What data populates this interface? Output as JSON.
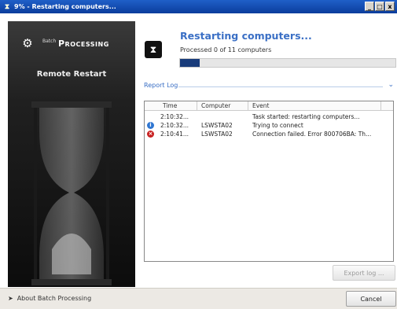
{
  "window": {
    "title": "9% - Restarting computers...",
    "min_glyph": "_",
    "max_glyph": "□",
    "close_glyph": "x"
  },
  "brand": {
    "batch": "Batch",
    "processing": "Processing"
  },
  "tool": {
    "name": "Remote Restart"
  },
  "task": {
    "title": "Restarting computers...",
    "subtitle": "Processed 0 of 11 computers",
    "progress_fraction": 0.09
  },
  "report": {
    "label": "Report Log"
  },
  "log": {
    "headers": {
      "time": "Time",
      "computer": "Computer",
      "event": "Event"
    },
    "rows": [
      {
        "severity": "none",
        "time": "2:10:32...",
        "computer": "",
        "event": "Task started: restarting computers..."
      },
      {
        "severity": "info",
        "time": "2:10:32...",
        "computer": "LSWSTA02",
        "event": "Trying to connect"
      },
      {
        "severity": "error",
        "time": "2:10:41...",
        "computer": "LSWSTA02",
        "event": "Connection failed. Error 800706BA: Th..."
      }
    ]
  },
  "buttons": {
    "export": "Export log ...",
    "cancel": "Cancel"
  },
  "footer": {
    "about": "About Batch Processing"
  },
  "colors": {
    "accent": "#3a6fc5",
    "progress": "#183b7a",
    "titlebar": "#0b3d9c"
  },
  "icons": {
    "title": "hourglass-icon",
    "brand": "gear-icon",
    "task": "hourglass-icon",
    "info": "info-icon",
    "error": "error-icon",
    "expand": "chevron-down-icon",
    "about": "arrow-right-icon"
  }
}
